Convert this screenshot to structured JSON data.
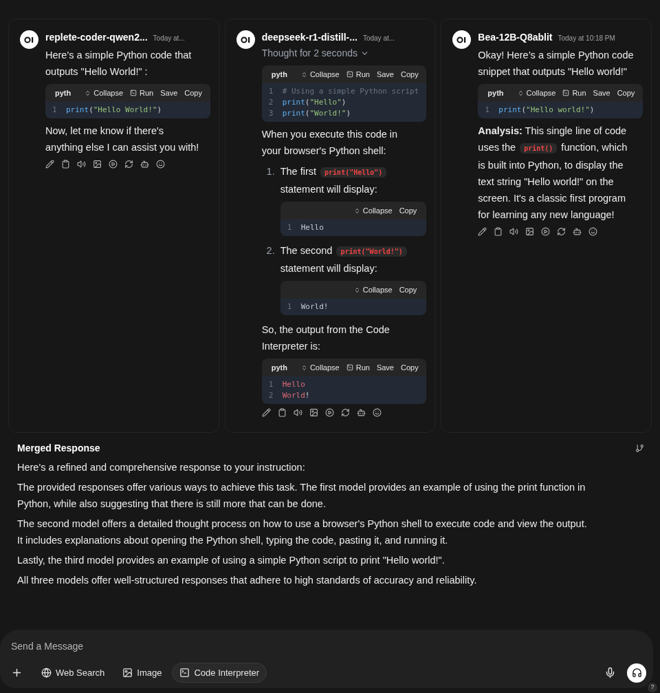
{
  "responses": [
    {
      "model": "replete-coder-qwen2...",
      "time": "Today at...",
      "blocks": [
        {
          "kind": "text",
          "parts": [
            {
              "kind": "text",
              "text": "Here's a simple Python code that outputs \"Hello World!\" :"
            }
          ]
        },
        {
          "kind": "code",
          "language": "pyth",
          "actions": [
            {
              "kind": "collapse",
              "label": "Collapse"
            },
            {
              "kind": "run",
              "label": "Run"
            },
            {
              "kind": "plain",
              "label": "Save"
            },
            {
              "kind": "plain",
              "label": "Copy"
            }
          ],
          "lines": [
            {
              "number": "1",
              "tokens": [
                {
                  "kind": "fn",
                  "text": "print"
                },
                {
                  "kind": "punct",
                  "text": "("
                },
                {
                  "kind": "string",
                  "text": "\"Hello World!\""
                },
                {
                  "kind": "punct",
                  "text": ")"
                }
              ]
            }
          ]
        },
        {
          "kind": "text",
          "parts": [
            {
              "kind": "text",
              "text": "Now, let me know if there's anything else I can assist you with!"
            }
          ]
        }
      ]
    },
    {
      "model": "deepseek-r1-distill-...",
      "time": "Today at...",
      "thought": "Thought for 2 seconds",
      "blocks": [
        {
          "kind": "code",
          "language": "pyth",
          "actions": [
            {
              "kind": "collapse",
              "label": "Collapse"
            },
            {
              "kind": "run",
              "label": "Run"
            },
            {
              "kind": "plain",
              "label": "Save"
            },
            {
              "kind": "plain",
              "label": "Copy"
            }
          ],
          "lines": [
            {
              "number": "1",
              "tokens": [
                {
                  "kind": "comment",
                  "text": "# Using a simple Python script"
                }
              ]
            },
            {
              "number": "2",
              "tokens": [
                {
                  "kind": "fn",
                  "text": "print"
                },
                {
                  "kind": "punct",
                  "text": "("
                },
                {
                  "kind": "string",
                  "text": "\"Hello\""
                },
                {
                  "kind": "punct",
                  "text": ")"
                }
              ]
            },
            {
              "number": "3",
              "tokens": [
                {
                  "kind": "fn",
                  "text": "print"
                },
                {
                  "kind": "punct",
                  "text": "("
                },
                {
                  "kind": "string",
                  "text": "\"World!\""
                },
                {
                  "kind": "punct",
                  "text": ")"
                }
              ]
            }
          ]
        },
        {
          "kind": "text",
          "parts": [
            {
              "kind": "text",
              "text": "When you execute this code in your browser's Python shell:"
            }
          ]
        },
        {
          "kind": "list",
          "items": [
            {
              "marker": "1.",
              "blocks": [
                {
                  "kind": "text",
                  "parts": [
                    {
                      "kind": "text",
                      "text": "The first "
                    },
                    {
                      "kind": "code",
                      "text": "print(\"Hello\")"
                    },
                    {
                      "kind": "text",
                      "text": " statement will display:"
                    }
                  ]
                },
                {
                  "kind": "code",
                  "actions": [
                    {
                      "kind": "collapse",
                      "label": "Collapse"
                    },
                    {
                      "kind": "plain",
                      "label": "Copy"
                    }
                  ],
                  "lines": [
                    {
                      "number": "1",
                      "tokens": [
                        {
                          "kind": "plain",
                          "text": "Hello"
                        }
                      ]
                    }
                  ]
                }
              ]
            },
            {
              "marker": "2.",
              "blocks": [
                {
                  "kind": "text",
                  "parts": [
                    {
                      "kind": "text",
                      "text": "The second "
                    },
                    {
                      "kind": "code",
                      "text": "print(\"World!\")"
                    },
                    {
                      "kind": "text",
                      "text": " statement will display:"
                    }
                  ]
                },
                {
                  "kind": "code",
                  "actions": [
                    {
                      "kind": "collapse",
                      "label": "Collapse"
                    },
                    {
                      "kind": "plain",
                      "label": "Copy"
                    }
                  ],
                  "lines": [
                    {
                      "number": "1",
                      "tokens": [
                        {
                          "kind": "plain",
                          "text": "World!"
                        }
                      ]
                    }
                  ]
                }
              ]
            }
          ]
        },
        {
          "kind": "text",
          "parts": [
            {
              "kind": "text",
              "text": "So, the output from the Code Interpreter is:"
            }
          ]
        },
        {
          "kind": "code",
          "language": "pyth",
          "actions": [
            {
              "kind": "collapse",
              "label": "Collapse"
            },
            {
              "kind": "run",
              "label": "Run"
            },
            {
              "kind": "plain",
              "label": "Save"
            },
            {
              "kind": "plain",
              "label": "Copy"
            }
          ],
          "lines": [
            {
              "number": "1",
              "tokens": [
                {
                  "kind": "output",
                  "text": "Hello"
                }
              ]
            },
            {
              "number": "2",
              "tokens": [
                {
                  "kind": "output",
                  "text": "World"
                },
                {
                  "kind": "punct",
                  "text": "!"
                }
              ]
            }
          ]
        }
      ]
    },
    {
      "model": "Bea-12B-Q8ablit",
      "time": "Today at 10:18 PM",
      "blocks": [
        {
          "kind": "text",
          "parts": [
            {
              "kind": "text",
              "text": "Okay! Here’s a simple Python code snippet that outputs \"Hello world!\""
            }
          ]
        },
        {
          "kind": "code",
          "language": "pyth",
          "actions": [
            {
              "kind": "collapse",
              "label": "Collapse"
            },
            {
              "kind": "run",
              "label": "Run"
            },
            {
              "kind": "plain",
              "label": "Save"
            },
            {
              "kind": "plain",
              "label": "Copy"
            }
          ],
          "lines": [
            {
              "number": "1",
              "tokens": [
                {
                  "kind": "fn",
                  "text": "print"
                },
                {
                  "kind": "punct",
                  "text": "("
                },
                {
                  "kind": "string",
                  "text": "\"Hello world!\""
                },
                {
                  "kind": "punct",
                  "text": ")"
                }
              ]
            }
          ]
        },
        {
          "kind": "text",
          "parts": [
            {
              "kind": "bold",
              "text": "Analysis:"
            },
            {
              "kind": "text",
              "text": " This single line of code uses the "
            },
            {
              "kind": "code",
              "text": "print()"
            },
            {
              "kind": "text",
              "text": " function, which is built into Python, to display the text string \"Hello world!\" on the screen. It's a classic first program for learning any new language!"
            }
          ]
        }
      ]
    }
  ],
  "merged": {
    "title": "Merged Response",
    "paragraphs": [
      "Here's a refined and comprehensive response to your instruction:",
      "The provided responses offer various ways to achieve this task. The first model provides an example of using the print function in Python, while also suggesting that there is still more that can be done.",
      "The second model offers a detailed thought process on how to use a browser's Python shell to execute code and view the output. It includes explanations about opening the Python shell, typing the code, pasting it, and running it.",
      "Lastly, the third model provides an example of using a simple Python script to print \"Hello world!\".",
      "All three models offer well-structured responses that adhere to high standards of accuracy and reliability."
    ]
  },
  "composer": {
    "placeholder": "Send a Message",
    "tools": [
      {
        "kind": "web",
        "label": "Web Search",
        "selected": false
      },
      {
        "kind": "image",
        "label": "Image",
        "selected": false
      },
      {
        "kind": "code",
        "label": "Code Interpreter",
        "selected": true
      }
    ]
  },
  "help": "?"
}
